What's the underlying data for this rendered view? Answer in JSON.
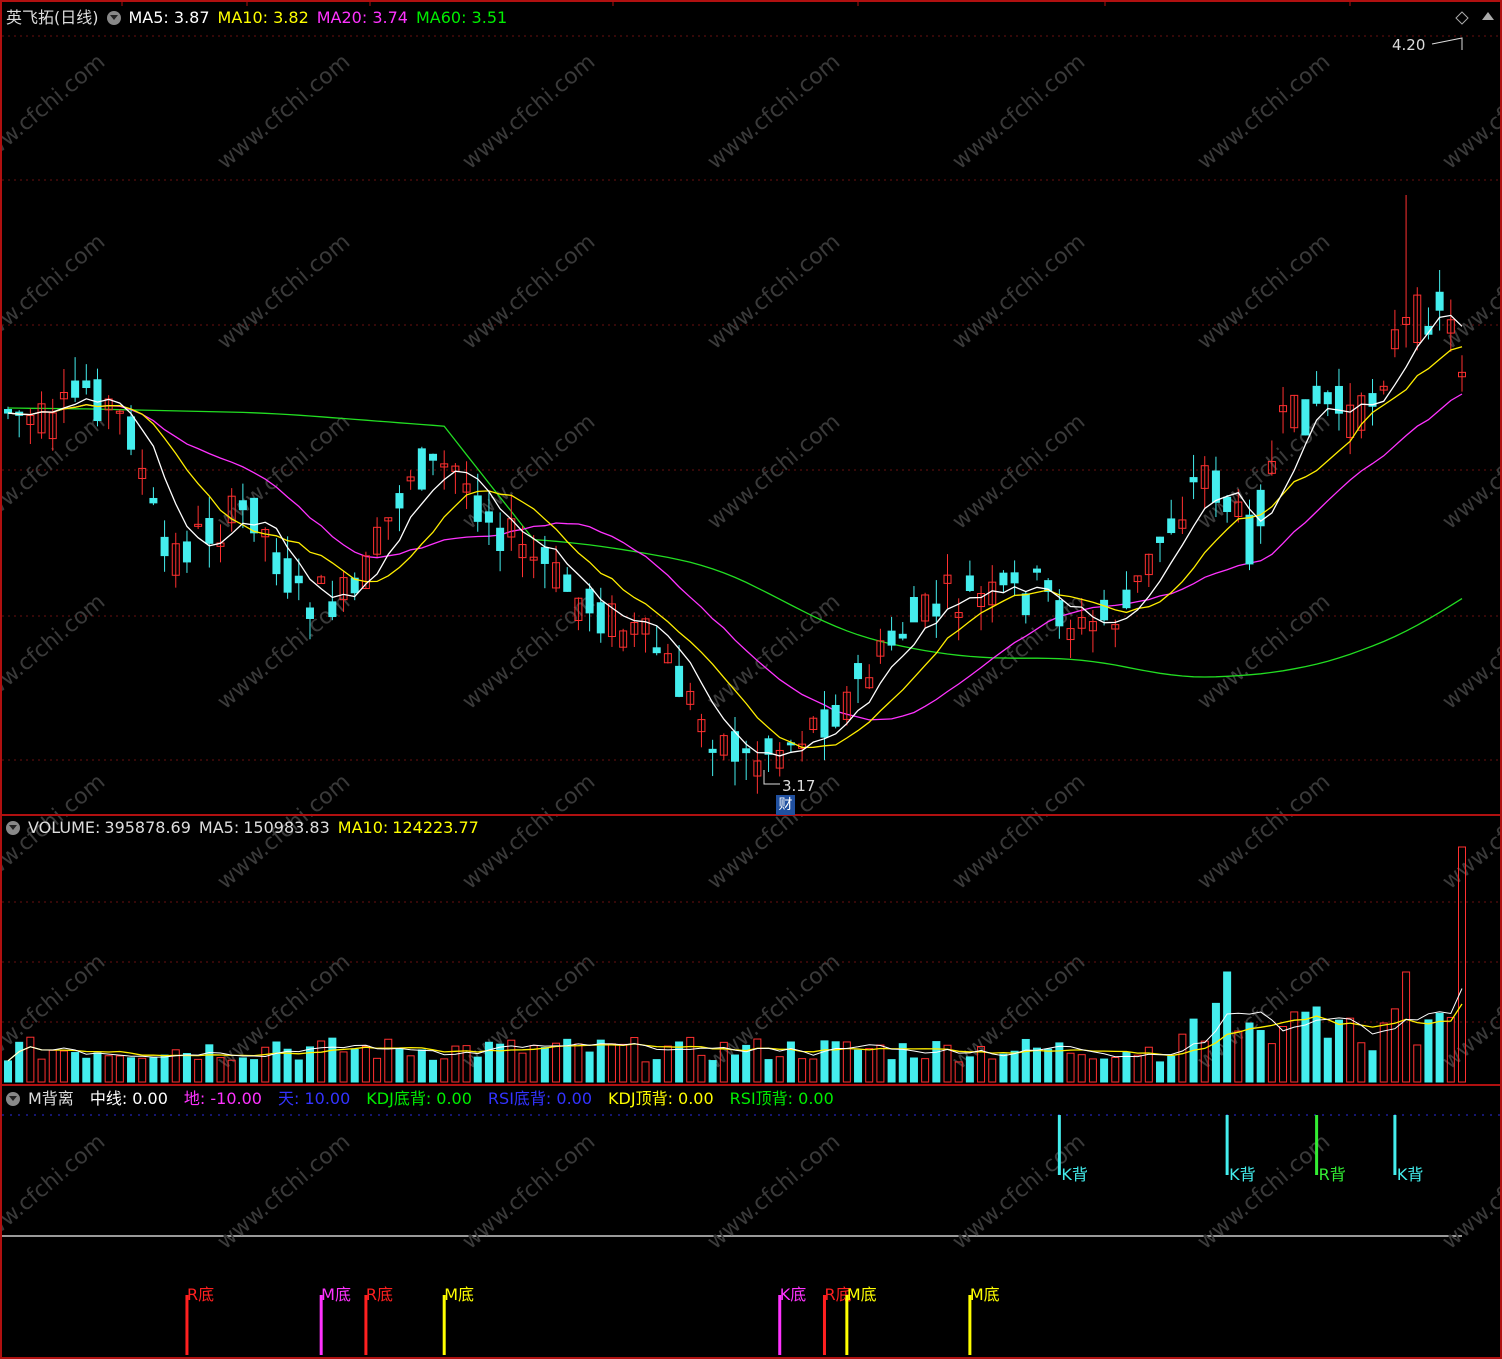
{
  "price_panel": {
    "title": "英飞拓(日线)",
    "ma_labels": [
      {
        "text": "MA5:",
        "value": "3.87",
        "color": "#ffffff"
      },
      {
        "text": "MA10:",
        "value": "3.82",
        "color": "#ffff00"
      },
      {
        "text": "MA20:",
        "value": "3.74",
        "color": "#ff33ff"
      },
      {
        "text": "MA60:",
        "value": "3.51",
        "color": "#00ee00"
      }
    ],
    "high_marker": "4.20",
    "low_marker": "3.17",
    "event_badge": "财"
  },
  "volume_panel": {
    "title": "VOLUME:",
    "value": "395878.69",
    "ma5_label": "MA5:",
    "ma5_value": "150983.83",
    "ma10_label": "MA10:",
    "ma10_value": "124223.77"
  },
  "indicator_panel": {
    "title": "M背离",
    "params": [
      {
        "label": "中线:",
        "value": "0.00",
        "color": "#ffffff"
      },
      {
        "label": "地:",
        "value": "-10.00",
        "color": "#ff33ff"
      },
      {
        "label": "天:",
        "value": "10.00",
        "color": "#3333ff"
      },
      {
        "label": "KDJ底背:",
        "value": "0.00",
        "color": "#00ee00"
      },
      {
        "label": "RSI底背:",
        "value": "0.00",
        "color": "#3333ff"
      },
      {
        "label": "KDJ顶背:",
        "value": "0.00",
        "color": "#ffff00"
      },
      {
        "label": "RSI顶背:",
        "value": "0.00",
        "color": "#00ee00"
      }
    ]
  },
  "watermark": "www.cfchi.com",
  "chart_data": {
    "type": "candlestick",
    "price_range": [
      3.0,
      4.3
    ],
    "signals_top": [
      {
        "index": 94,
        "label": "K背",
        "color": "#44eeee"
      },
      {
        "index": 109,
        "label": "K背",
        "color": "#44eeee"
      },
      {
        "index": 117,
        "label": "R背",
        "color": "#33ee33"
      },
      {
        "index": 124,
        "label": "K背",
        "color": "#44eeee"
      }
    ],
    "signals_bottom": [
      {
        "index": 16,
        "label": "R底",
        "color": "#ff2020"
      },
      {
        "index": 28,
        "label": "M底",
        "color": "#ff33ff"
      },
      {
        "index": 32,
        "label": "R底",
        "color": "#ff2020"
      },
      {
        "index": 39,
        "label": "M底",
        "color": "#ffff00"
      },
      {
        "index": 69,
        "label": "K底",
        "color": "#ff33ff"
      },
      {
        "index": 73,
        "label": "R底",
        "color": "#ff2020"
      },
      {
        "index": 75,
        "label": "M底",
        "color": "#ffff00"
      },
      {
        "index": 86,
        "label": "M底",
        "color": "#ffff00"
      }
    ]
  }
}
